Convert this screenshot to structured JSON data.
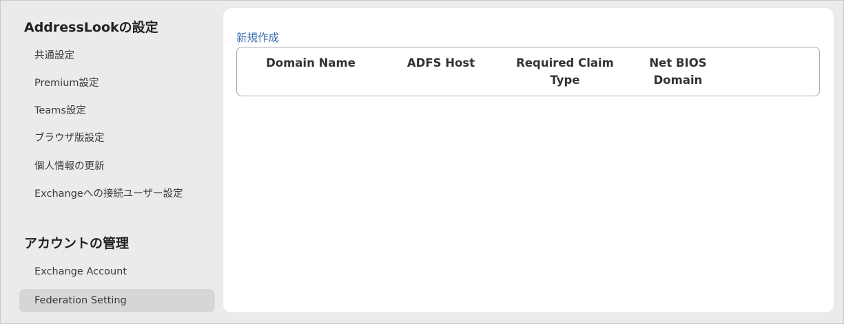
{
  "sidebar": {
    "section1_title": "AddressLookの設定",
    "section1_items": [
      "共通設定",
      "Premium設定",
      "Teams設定",
      "ブラウザ版設定",
      "個人情報の更新",
      "Exchangeへの接続ユーザー設定"
    ],
    "section2_title": "アカウントの管理",
    "section2_items": [
      "Exchange Account",
      "Federation Setting"
    ],
    "active_item": "Federation Setting"
  },
  "main": {
    "new_link": "新規作成",
    "columns": [
      {
        "line1": "Domain Name",
        "line2": ""
      },
      {
        "line1": "ADFS Host",
        "line2": ""
      },
      {
        "line1": "Required Claim",
        "line2": "Type"
      },
      {
        "line1": "Net BIOS",
        "line2": "Domain"
      }
    ]
  },
  "colors": {
    "background": "#ebebeb",
    "panel": "#ffffff",
    "link": "#3b6db3",
    "active_item_bg": "#d6d6d6"
  }
}
